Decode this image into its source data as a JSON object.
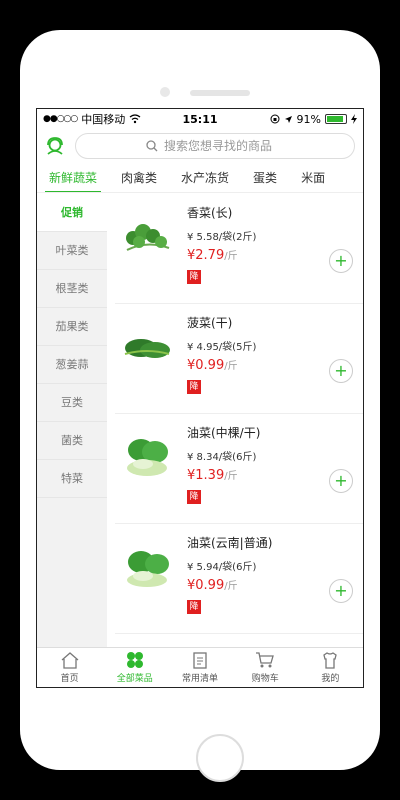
{
  "status": {
    "carrier": "中国移动",
    "time": "15:11",
    "battery": "91%",
    "battery_level": 0.91
  },
  "search": {
    "placeholder": "搜索您想寻找的商品"
  },
  "tabs": [
    "新鲜蔬菜",
    "肉禽类",
    "水产冻货",
    "蛋类",
    "米面"
  ],
  "sidebar": [
    "促销",
    "叶菜类",
    "根茎类",
    "茄果类",
    "葱姜蒜",
    "豆类",
    "菌类",
    "特菜"
  ],
  "products": [
    {
      "name": "香菜(长)",
      "spec": "¥ 5.58/袋(2斤)",
      "price": "¥2.79",
      "unit": "/斤",
      "badge": "降"
    },
    {
      "name": "菠菜(干)",
      "spec": "¥ 4.95/袋(5斤)",
      "price": "¥0.99",
      "unit": "/斤",
      "badge": "降"
    },
    {
      "name": "油菜(中棵/干)",
      "spec": "¥ 8.34/袋(6斤)",
      "price": "¥1.39",
      "unit": "/斤",
      "badge": "降"
    },
    {
      "name": "油菜(云南|普通)",
      "spec": "¥ 5.94/袋(6斤)",
      "price": "¥0.99",
      "unit": "/斤",
      "badge": "降"
    }
  ],
  "nav": [
    "首页",
    "全部菜品",
    "常用清单",
    "购物车",
    "我的"
  ],
  "colors": {
    "accent": "#2eb82e",
    "price": "#e02020"
  }
}
